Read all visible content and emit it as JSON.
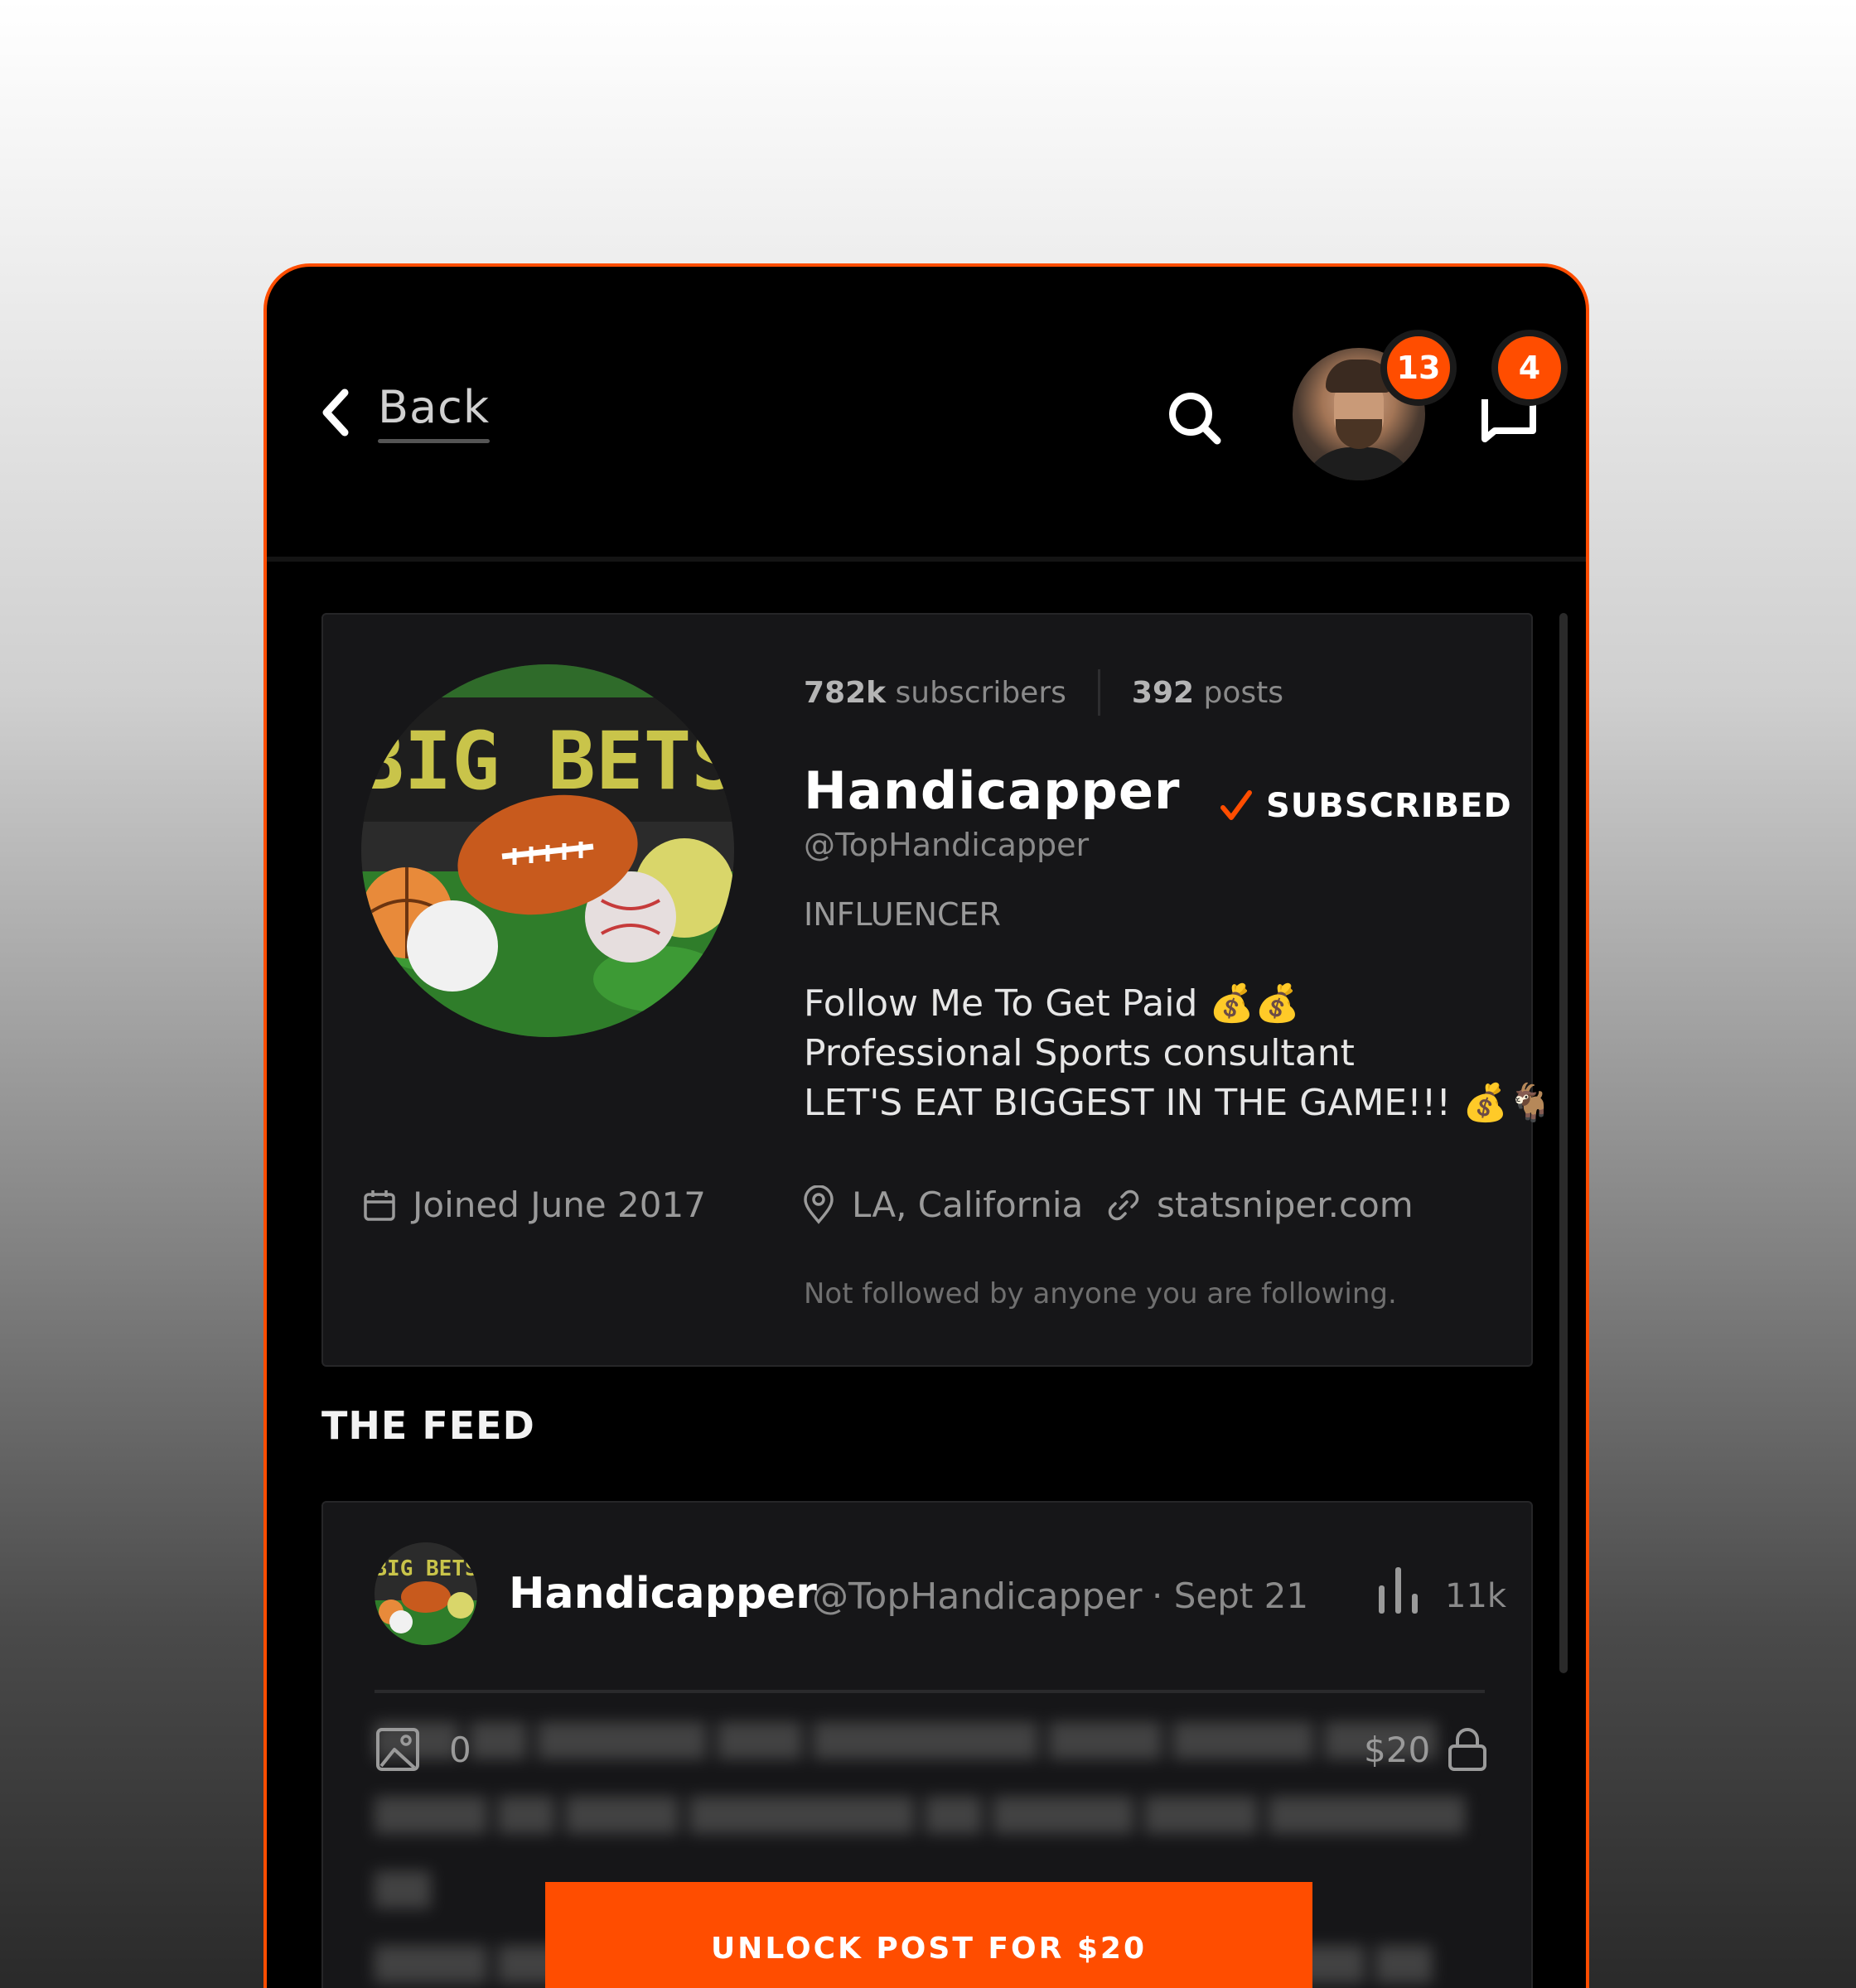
{
  "header": {
    "back_label": "Back",
    "notifications_badge": "13",
    "messages_badge": "4"
  },
  "profile": {
    "subscribers_count": "782k",
    "subscribers_label": "subscribers",
    "posts_count": "392",
    "posts_label": "posts",
    "name": "Handicapper",
    "handle": "@TopHandicapper",
    "subscribed_label": "SUBSCRIBED",
    "role": "INFLUENCER",
    "bio": [
      "Follow Me To Get Paid 💰💰",
      "Professional Sports consultant",
      "LET'S EAT BIGGEST IN THE GAME!!! 💰🐐"
    ],
    "joined": "Joined June 2017",
    "location": "LA, California",
    "website": "statsniper.com",
    "followers_note": "Not followed by anyone you are following.",
    "avatar_text": "BIG BETS"
  },
  "feed": {
    "title": "THE FEED",
    "post": {
      "author_name": "Handicapper",
      "author_handle": "@TopHandicapper",
      "date": "· Sept 21",
      "views": "11k",
      "media_count": "0",
      "price": "$20",
      "unlock_label": "UNLOCK POST FOR $20"
    }
  },
  "colors": {
    "accent": "#ff4d00",
    "background": "#000000",
    "card": "#161618"
  }
}
